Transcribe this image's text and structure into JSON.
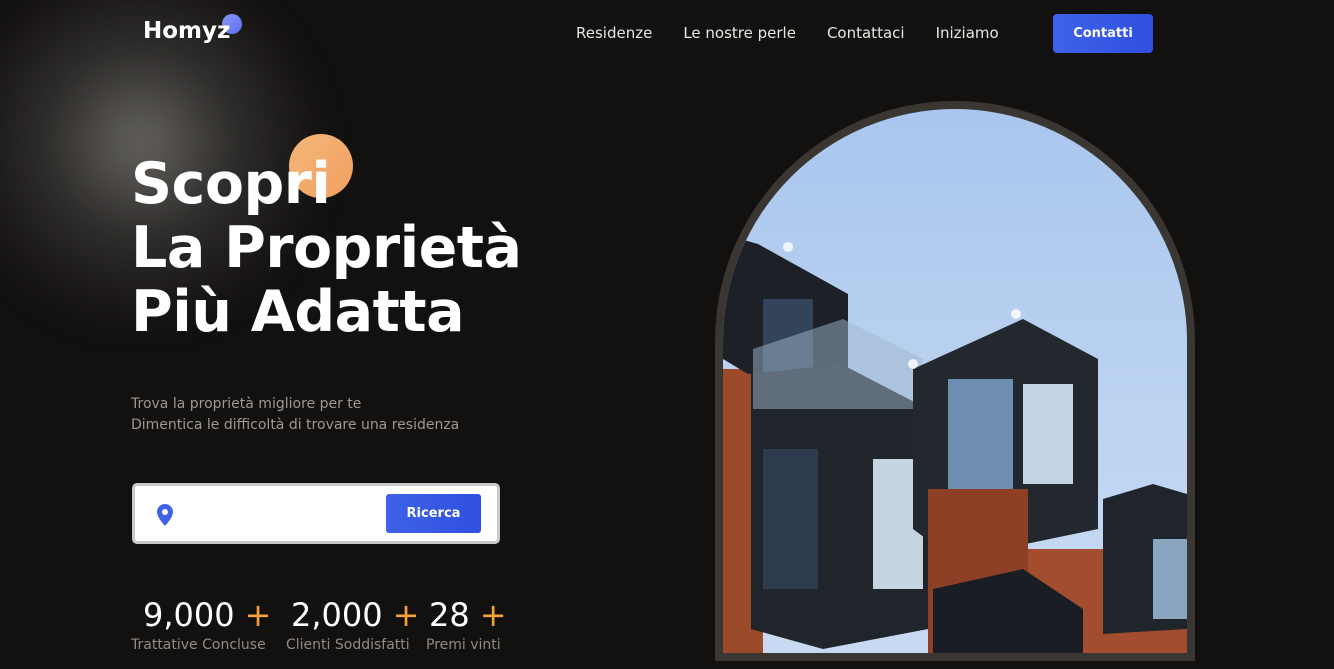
{
  "header": {
    "logo": "Homyz",
    "nav": [
      "Residenze",
      "Le nostre perle",
      "Contattaci",
      "Iniziamo"
    ],
    "cta_label": "Contatti"
  },
  "hero": {
    "title_lines": [
      "Scopri",
      "La Proprietà",
      "Più Adatta"
    ],
    "subtitle_lines": [
      "Trova la proprietà migliore per te",
      "Dimentica le difficoltà di trovare una residenza"
    ],
    "search": {
      "icon": "location-pin-icon",
      "value": "",
      "button_label": "Ricerca"
    },
    "stats": [
      {
        "value": "9,000",
        "suffix": "+",
        "label": "Trattative Concluse"
      },
      {
        "value": "2,000",
        "suffix": "+",
        "label": "Clienti Soddisfatti"
      },
      {
        "value": "28",
        "suffix": "+",
        "label": "Premi vinti"
      }
    ]
  },
  "colors": {
    "background": "#131110",
    "accent_blue": "#3f62e8",
    "accent_orange": "#f5a13c"
  }
}
